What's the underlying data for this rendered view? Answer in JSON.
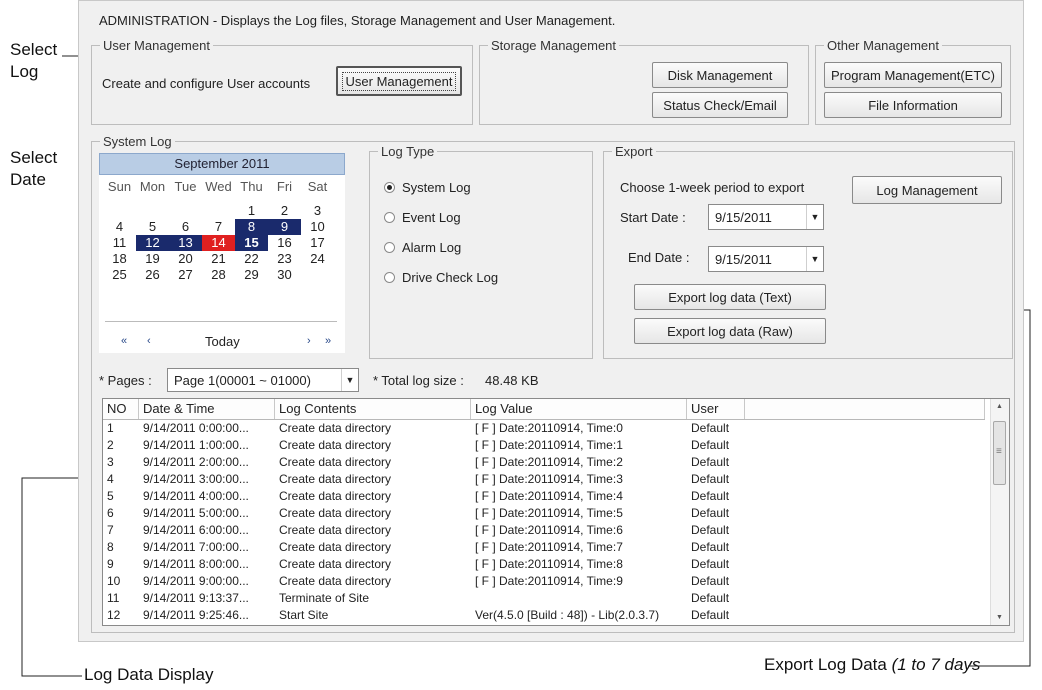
{
  "header": {
    "title": "ADMINISTRATION - Displays the Log files,  Storage Management and User Management."
  },
  "annotations": {
    "select_log": [
      "Select",
      "Log"
    ],
    "select_date": [
      "Select",
      "Date"
    ],
    "log_data_display": "Log Data Display",
    "export_log_data": "Export Log Data",
    "export_log_data_days": "(1 to 7 days"
  },
  "user_management": {
    "title": "User Management",
    "description": "Create and configure User accounts",
    "button": "User Management"
  },
  "storage_management": {
    "title": "Storage Management",
    "disk_button": "Disk Management",
    "status_button": "Status Check/Email"
  },
  "other_management": {
    "title": "Other Management",
    "program_button": "Program Management(ETC)",
    "file_button": "File Information"
  },
  "system_log": {
    "title": "System Log",
    "calendar": {
      "month": "September 2011",
      "day_names": [
        "Sun",
        "Mon",
        "Tue",
        "Wed",
        "Thu",
        "Fri",
        "Sat"
      ],
      "today_label": "Today",
      "nav_first": "«",
      "nav_prev": "‹",
      "nav_next": "›",
      "nav_last": "»",
      "weeks": [
        [
          "",
          "",
          "",
          "",
          "1",
          "2",
          "3"
        ],
        [
          "4",
          "5",
          "6",
          "7",
          "8",
          "9",
          "10"
        ],
        [
          "11",
          "12",
          "13",
          "14",
          "15",
          "16",
          "17"
        ],
        [
          "18",
          "19",
          "20",
          "21",
          "22",
          "23",
          "24"
        ],
        [
          "25",
          "26",
          "27",
          "28",
          "29",
          "30",
          ""
        ]
      ],
      "selected_days": [
        "8",
        "9",
        "12",
        "13",
        "15"
      ],
      "today_day": "14"
    },
    "log_type": {
      "title": "Log Type",
      "options": [
        "System Log",
        "Event Log",
        "Alarm Log",
        "Drive Check Log"
      ],
      "selected": "System Log"
    },
    "export": {
      "title": "Export",
      "hint": "Choose 1-week period to export",
      "start_label": "Start Date :",
      "start_value": "9/15/2011",
      "end_label": "End Date :",
      "end_value": "9/15/2011",
      "export_text_button": "Export log data (Text)",
      "export_raw_button": "Export log data (Raw)",
      "log_management_button": "Log Management"
    },
    "pages_label": "* Pages :",
    "pages_value": "Page 1(00001 ~ 01000)",
    "total_label": "* Total log size :",
    "total_value": "48.48 KB"
  },
  "log_table": {
    "columns": [
      "NO",
      "Date & Time",
      "Log Contents",
      "Log Value",
      "User",
      ""
    ],
    "rows": [
      [
        "1",
        "9/14/2011 0:00:00...",
        "Create data directory",
        "[ F ] Date:20110914, Time:0",
        "Default"
      ],
      [
        "2",
        "9/14/2011 1:00:00...",
        "Create data directory",
        "[ F ] Date:20110914, Time:1",
        "Default"
      ],
      [
        "3",
        "9/14/2011 2:00:00...",
        "Create data directory",
        "[ F ] Date:20110914, Time:2",
        "Default"
      ],
      [
        "4",
        "9/14/2011 3:00:00...",
        "Create data directory",
        "[ F ] Date:20110914, Time:3",
        "Default"
      ],
      [
        "5",
        "9/14/2011 4:00:00...",
        "Create data directory",
        "[ F ] Date:20110914, Time:4",
        "Default"
      ],
      [
        "6",
        "9/14/2011 5:00:00...",
        "Create data directory",
        "[ F ] Date:20110914, Time:5",
        "Default"
      ],
      [
        "7",
        "9/14/2011 6:00:00...",
        "Create data directory",
        "[ F ] Date:20110914, Time:6",
        "Default"
      ],
      [
        "8",
        "9/14/2011 7:00:00...",
        "Create data directory",
        "[ F ] Date:20110914, Time:7",
        "Default"
      ],
      [
        "9",
        "9/14/2011 8:00:00...",
        "Create data directory",
        "[ F ] Date:20110914, Time:8",
        "Default"
      ],
      [
        "10",
        "9/14/2011 9:00:00...",
        "Create data directory",
        "[ F ] Date:20110914, Time:9",
        "Default"
      ],
      [
        "11",
        "9/14/2011 9:13:37...",
        "Terminate of Site",
        "",
        "Default"
      ],
      [
        "12",
        "9/14/2011 9:25:46...",
        "Start Site",
        "Ver(4.5.0 [Build : 48]) - Lib(2.0.3.7)",
        "Default"
      ]
    ]
  },
  "icons": {
    "dropdown": "▼",
    "scroll_up": "▲",
    "scroll_down": "▼",
    "scroll_grip": "≡"
  }
}
